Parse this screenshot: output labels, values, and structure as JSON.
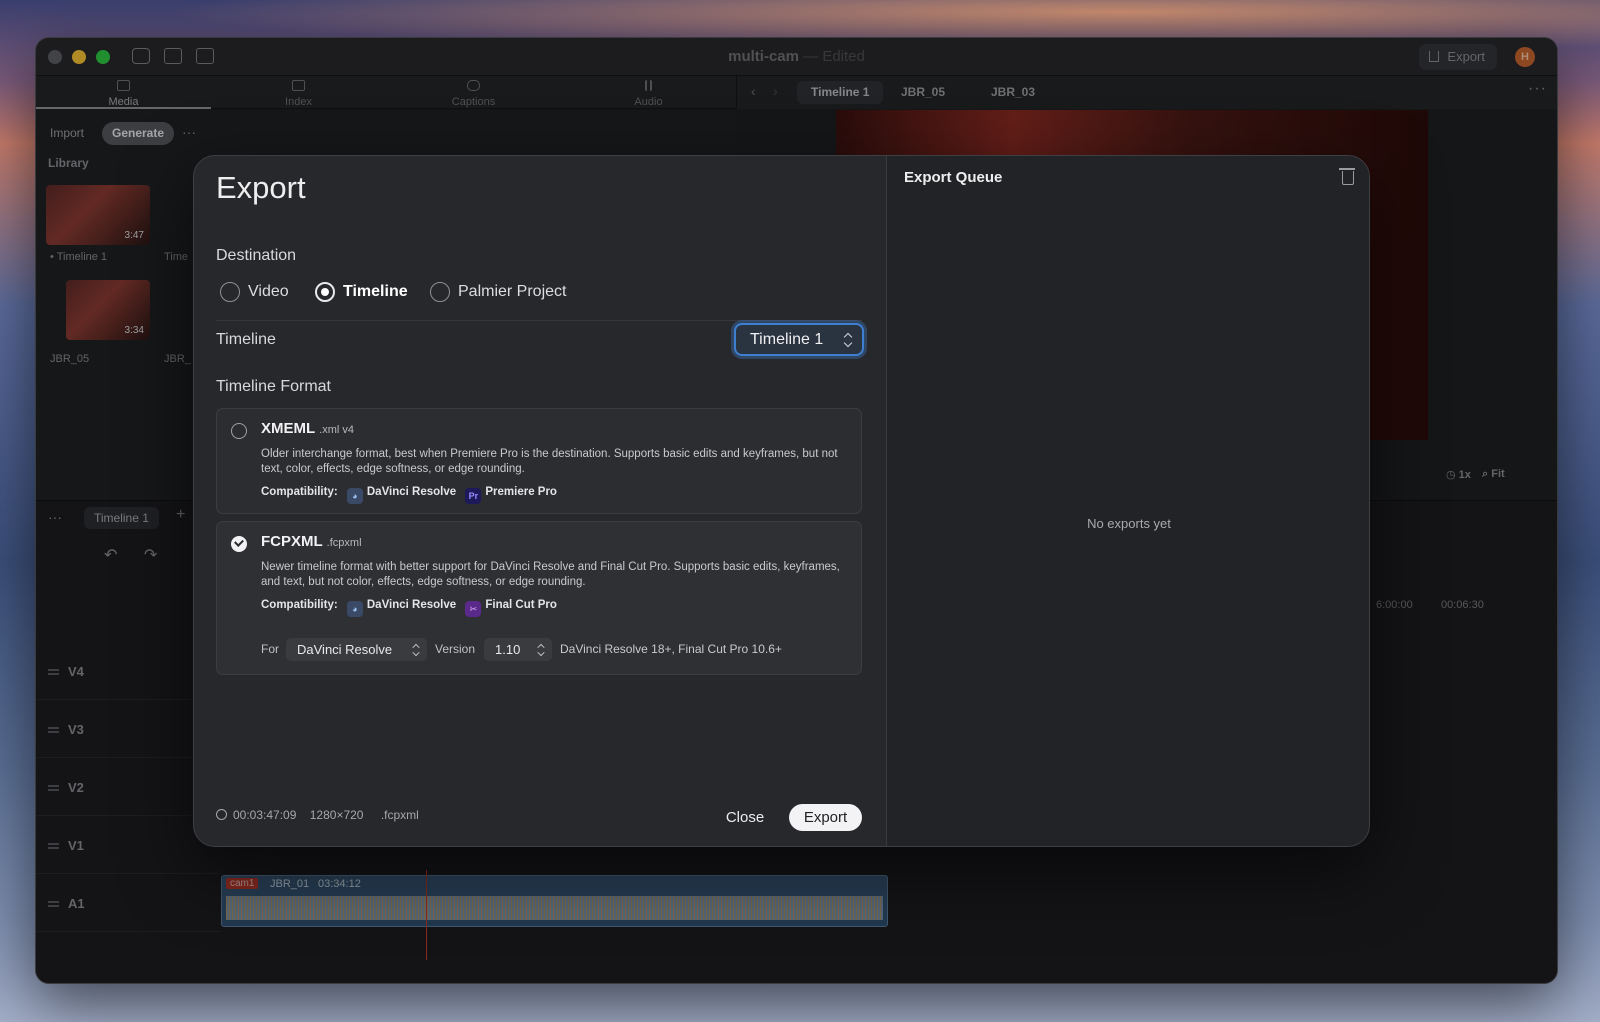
{
  "window": {
    "title": "multi-cam",
    "title_suffix": "— Edited",
    "export_label": "Export",
    "avatar_letter": "H"
  },
  "media_tabs": [
    "Media",
    "Index",
    "Captions",
    "Audio"
  ],
  "viewer_tabs": [
    "Timeline 1",
    "JBR_05",
    "JBR_03"
  ],
  "library": {
    "import_label": "Import",
    "generate_label": "Generate",
    "section": "Library",
    "items": [
      {
        "name": "Timeline 1",
        "duration": "3:47"
      },
      {
        "name": "JBR_05",
        "duration": "3:34"
      }
    ],
    "partial_names": [
      "Time",
      "JBR_"
    ]
  },
  "viewer_controls": {
    "speed": "1x",
    "zoom": "Fit"
  },
  "timeline": {
    "tab": "Timeline 1",
    "tracks": [
      "V4",
      "V3",
      "V2",
      "V1",
      "A1"
    ],
    "ruler": [
      "6:00:00",
      "00:06:30"
    ],
    "audio_clip": {
      "badge": "cam1",
      "name": "JBR_01",
      "timecode": "03:34:12"
    }
  },
  "export_dialog": {
    "title": "Export",
    "destination_label": "Destination",
    "destinations": [
      {
        "label": "Video",
        "selected": false
      },
      {
        "label": "Timeline",
        "selected": true
      },
      {
        "label": "Palmier Project",
        "selected": false
      }
    ],
    "timeline_label": "Timeline",
    "timeline_value": "Timeline 1",
    "format_label": "Timeline Format",
    "formats": [
      {
        "name": "XMEML",
        "ext": ".xml v4",
        "selected": false,
        "description": "Older interchange format, best when Premiere Pro is the destination. Supports basic edits and keyframes, but not text, color, effects, edge softness, or edge rounding.",
        "compat_label": "Compatibility:",
        "apps": [
          "DaVinci Resolve",
          "Premiere Pro"
        ]
      },
      {
        "name": "FCPXML",
        "ext": ".fcpxml",
        "selected": true,
        "description": "Newer timeline format with better support for DaVinci Resolve and Final Cut Pro. Supports basic edits, keyframes, and text, but not color, effects, edge softness, or edge rounding.",
        "compat_label": "Compatibility:",
        "apps": [
          "DaVinci Resolve",
          "Final Cut Pro"
        ]
      }
    ],
    "for_label": "For",
    "for_value": "DaVinci Resolve",
    "version_label": "Version",
    "version_value": "1.10",
    "version_note": "DaVinci Resolve 18+, Final Cut Pro 10.6+",
    "footer": {
      "duration": "00:03:47:09",
      "resolution": "1280×720",
      "format": ".fcpxml"
    },
    "close_label": "Close",
    "export_label": "Export"
  },
  "export_queue": {
    "title": "Export Queue",
    "empty": "No exports yet"
  },
  "colors": {
    "accent": "#3f7fd0",
    "record": "#c0392b",
    "window": "#1e1f22"
  }
}
